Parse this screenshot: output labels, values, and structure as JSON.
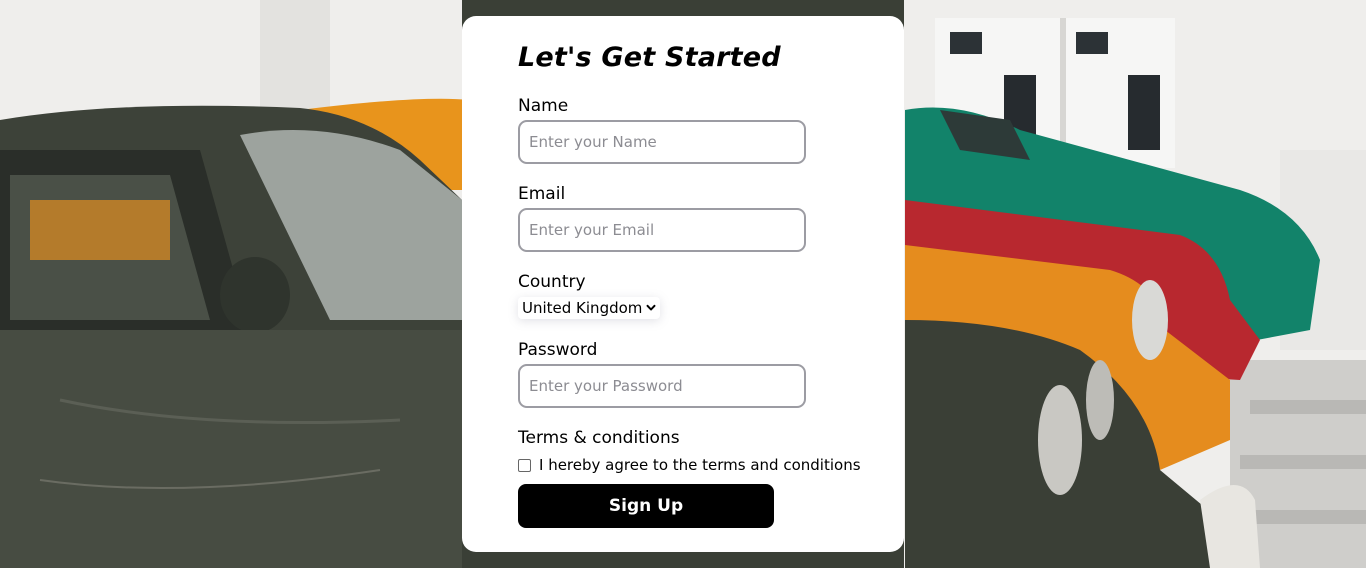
{
  "form": {
    "title": "Let's Get Started",
    "name_label": "Name",
    "name_placeholder": "Enter your Name",
    "name_value": "",
    "email_label": "Email",
    "email_placeholder": "Enter your Email",
    "email_value": "",
    "country_label": "Country",
    "country_selected": "United Kingdom",
    "password_label": "Password",
    "password_placeholder": "Enter your Password",
    "password_value": "",
    "terms_label": "Terms & conditions",
    "terms_checkbox_label": "I hereby agree to the terms and conditions",
    "terms_checked": false,
    "submit_label": "Sign Up"
  },
  "icons": {
    "select_arrow": "chevron-down-icon"
  },
  "colors": {
    "card_background": "#ffffff",
    "button_background": "#000000",
    "button_text": "#ffffff",
    "input_border": "#9c9ca3"
  }
}
